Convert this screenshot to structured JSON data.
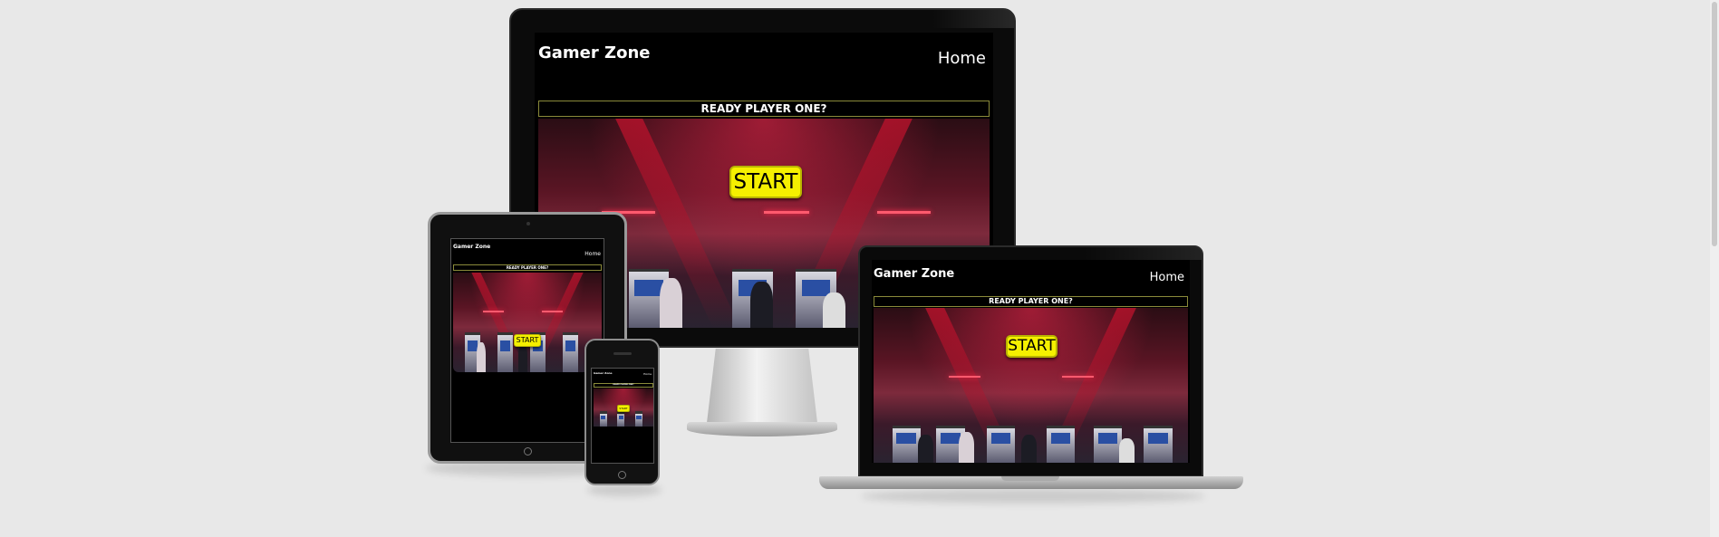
{
  "site": {
    "brand": "Gamer Zone",
    "nav_home": "Home",
    "banner": "READY PLAYER ONE?",
    "start_label": "START"
  },
  "colors": {
    "page_background": "#e8e8e8",
    "site_background": "#000000",
    "start_button": "#f5f000"
  },
  "icons": {
    "tablet_home_button": "home-button-icon",
    "phone_home_button": "home-button-icon"
  }
}
